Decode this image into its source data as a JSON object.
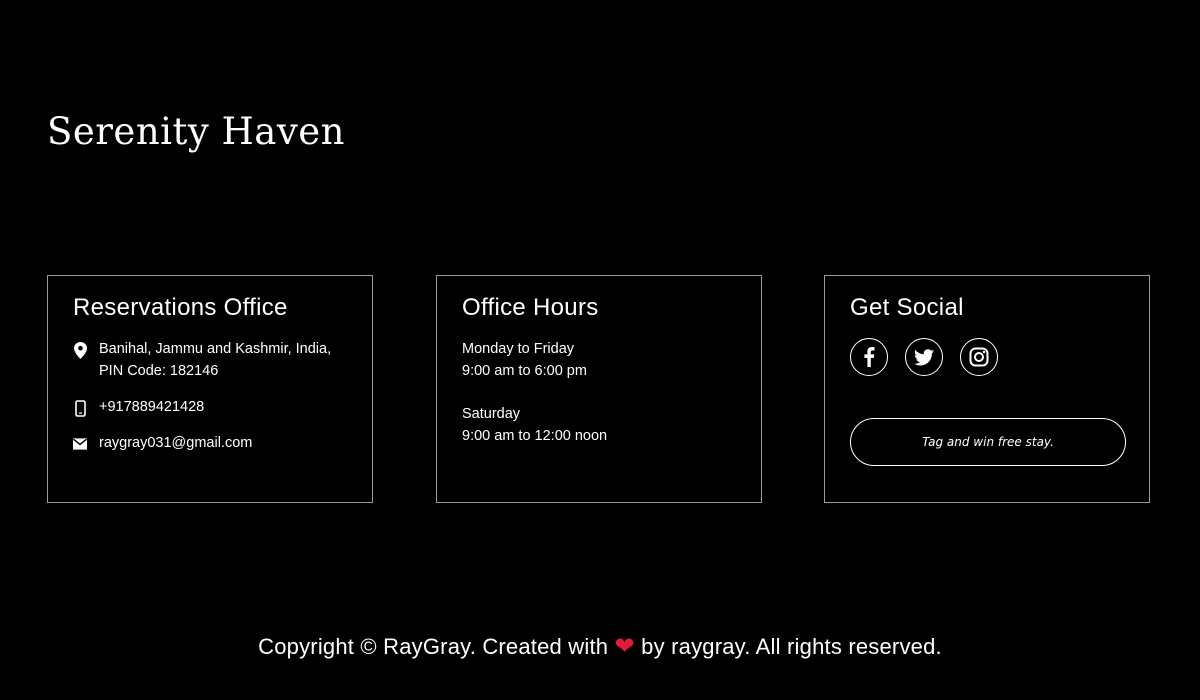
{
  "brand": {
    "title": "Serenity Haven"
  },
  "reservations": {
    "heading": "Reservations Office",
    "address_line1": "Banihal, Jammu and Kashmir, India,",
    "address_line2": "PIN Code: 182146",
    "phone": "+917889421428",
    "email": "raygray031@gmail.com",
    "icons": [
      "location-pin-icon",
      "phone-icon",
      "mail-icon"
    ]
  },
  "hours": {
    "heading": "Office Hours",
    "weekday_label": "Monday to Friday",
    "weekday_time": "9:00 am to 6:00 pm",
    "saturday_label": "Saturday",
    "saturday_time": "9:00 am to 12:00 noon"
  },
  "social": {
    "heading": "Get Social",
    "icons": [
      "facebook-icon",
      "twitter-icon",
      "instagram-icon"
    ],
    "button_label": "Tag and win free stay."
  },
  "footer": {
    "text_before": "Copyright © RayGray. Created with",
    "heart": "❤",
    "text_after": "by raygray. All rights reserved.",
    "heart_color": "#e31b3b"
  }
}
